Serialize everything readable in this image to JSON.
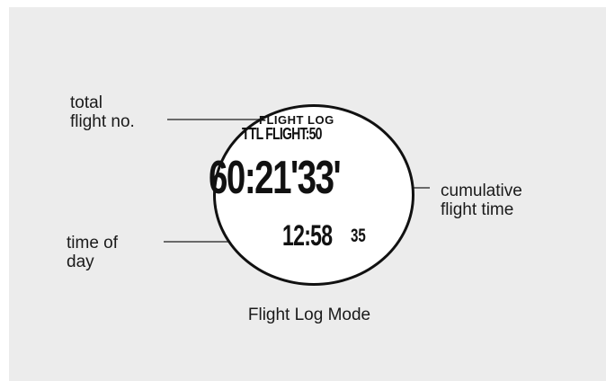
{
  "callouts": {
    "total_flight_no": "total\nflight no.",
    "cumulative_flight_time": "cumulative\nflight time",
    "time_of_day": "time of\nday"
  },
  "watch": {
    "mode_title": "FLIGHT LOG",
    "total_flights": "TTL FLIGHT:50",
    "cumulative_time": "60:21ʹ33ʹ",
    "clock_hm": "12:58",
    "clock_seconds": "35"
  },
  "caption": "Flight Log Mode",
  "colors": {
    "panel_background": "#ececec",
    "ink": "#111111",
    "leader_line": "#6a6a6a"
  }
}
